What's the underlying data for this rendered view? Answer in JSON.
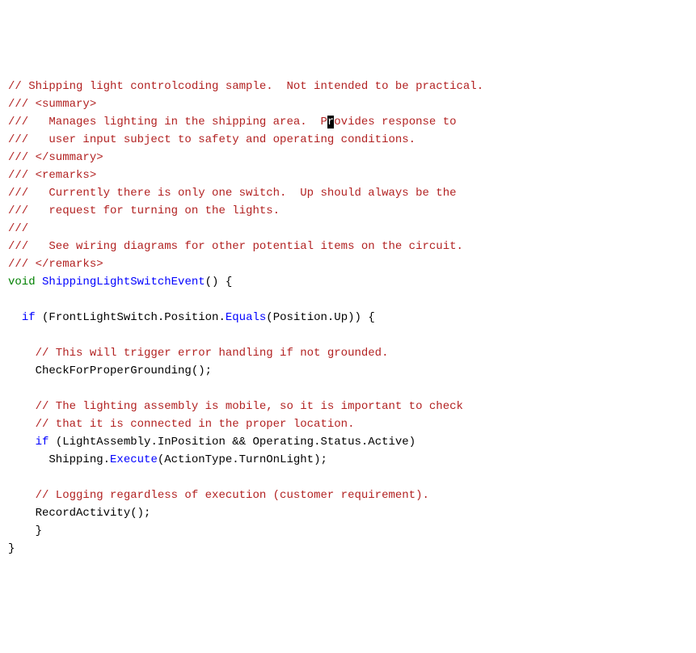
{
  "code": {
    "l01_a": "// Shipping light controlcoding sample.  Not intended to be practical.",
    "l02_a": "/// <summary>",
    "l03_a": "///   Manages lighting in the shipping area.  P",
    "l03_cur": "r",
    "l03_b": "ovides response to",
    "l04_a": "///   user input subject to safety and operating conditions.",
    "l05_a": "/// </summary>",
    "l06_a": "/// <remarks>",
    "l07_a": "///   Currently there is only one switch.  Up should always be the",
    "l08_a": "///   request for turning on the lights.",
    "l09_a": "///",
    "l10_a": "///   See wiring diagrams for other potential items on the circuit.",
    "l11_a": "/// </remarks>",
    "l12_kw": "void",
    "l12_sp": " ",
    "l12_fn": "ShippingLightSwitchEvent",
    "l12_rest": "() {",
    "l13_blank": "",
    "l14_a": "  ",
    "l14_if": "if",
    "l14_b": " (FrontLightSwitch.Position.",
    "l14_eq": "Equals",
    "l14_c": "(Position.Up)) {",
    "l15_blank": "",
    "l16_a": "    // This will trigger error handling if not grounded.",
    "l17_a": "    CheckForProperGrounding();",
    "l18_blank": "",
    "l19_a": "    // The lighting assembly is mobile, so it is important to check",
    "l20_a": "    // that it is connected in the proper location.",
    "l21_a": "    ",
    "l21_if": "if",
    "l21_b": " (LightAssembly.InPosition && Operating.Status.Active)",
    "l22_a": "      Shipping.",
    "l22_ex": "Execute",
    "l22_b": "(ActionType.TurnOnLight);",
    "l23_blank": "",
    "l24_a": "    // Logging regardless of execution (customer requirement).",
    "l25_a": "    RecordActivity();",
    "l26_a": "    }",
    "l27_a": "}"
  }
}
